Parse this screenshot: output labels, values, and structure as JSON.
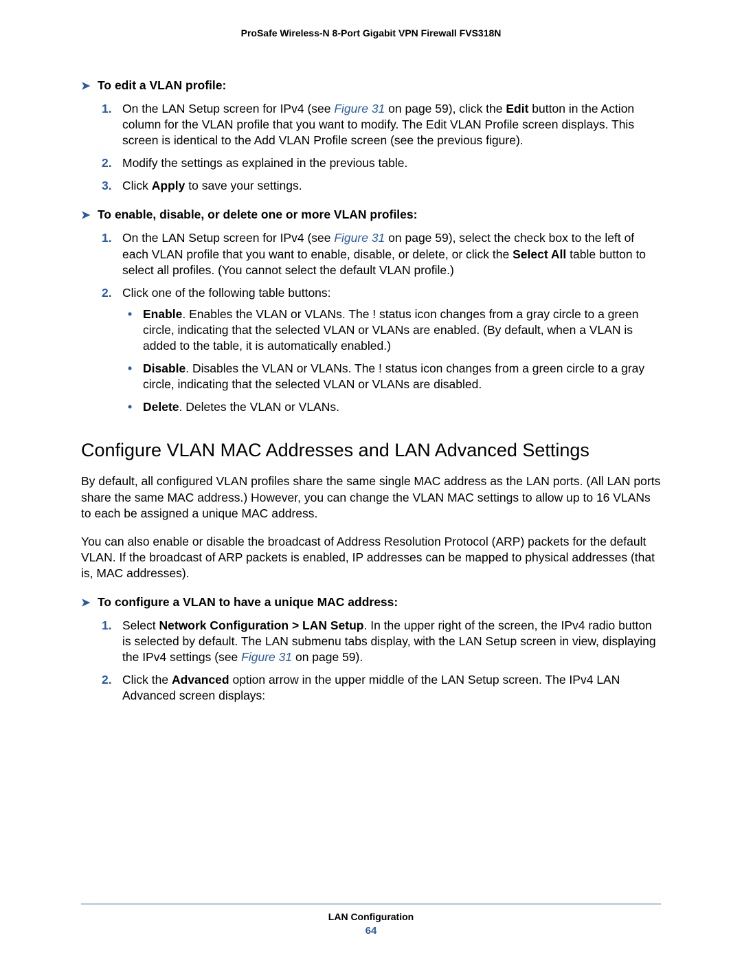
{
  "header": {
    "title": "ProSafe Wireless-N 8-Port Gigabit VPN Firewall FVS318N"
  },
  "proc1": {
    "heading": "To edit a VLAN profile:",
    "steps": [
      {
        "num": "1.",
        "segs": [
          {
            "t": "On the LAN Setup screen for IPv4 (see "
          },
          {
            "t": "Figure 31",
            "cls": "link"
          },
          {
            "t": " on page 59), click the "
          },
          {
            "t": "Edit",
            "cls": "bold"
          },
          {
            "t": " button in the Action column for the VLAN profile that you want to modify. The Edit VLAN Profile screen displays. This screen is identical to the Add VLAN Profile screen (see the previous figure)."
          }
        ]
      },
      {
        "num": "2.",
        "segs": [
          {
            "t": "Modify the settings as explained in the previous table."
          }
        ]
      },
      {
        "num": "3.",
        "segs": [
          {
            "t": "Click "
          },
          {
            "t": "Apply",
            "cls": "bold"
          },
          {
            "t": " to save your settings."
          }
        ]
      }
    ]
  },
  "proc2": {
    "heading": "To enable, disable, or delete one or more VLAN profiles:",
    "steps": [
      {
        "num": "1.",
        "segs": [
          {
            "t": "On the LAN Setup screen for IPv4 (see "
          },
          {
            "t": "Figure 31",
            "cls": "link"
          },
          {
            "t": " on page 59), select the check box to the left of each VLAN profile that you want to enable, disable, or delete, or click the "
          },
          {
            "t": "Select All",
            "cls": "bold"
          },
          {
            "t": " table button to select all profiles. (You cannot select the default VLAN profile.)"
          }
        ]
      },
      {
        "num": "2.",
        "segs": [
          {
            "t": "Click one of the following table buttons:"
          }
        ],
        "bullets": [
          {
            "segs": [
              {
                "t": "Enable",
                "cls": "bold"
              },
              {
                "t": ". Enables the VLAN or VLANs. The ! status icon changes from a gray circle to a green circle, indicating that the selected VLAN or VLANs are enabled. (By default, when a VLAN is added to the table, it is automatically enabled.)"
              }
            ]
          },
          {
            "segs": [
              {
                "t": "Disable",
                "cls": "bold"
              },
              {
                "t": ". Disables the VLAN or VLANs. The ! status icon changes from a green circle to a gray circle, indicating that the selected VLAN or VLANs are disabled."
              }
            ]
          },
          {
            "segs": [
              {
                "t": "Delete",
                "cls": "bold"
              },
              {
                "t": ". Deletes the VLAN or VLANs."
              }
            ]
          }
        ]
      }
    ]
  },
  "section": {
    "heading": "Configure VLAN MAC Addresses and LAN Advanced Settings",
    "para1": "By default, all configured VLAN profiles share the same single MAC address as the LAN ports. (All LAN ports share the same MAC address.) However, you can change the VLAN MAC settings to allow up to 16 VLANs to each be assigned a unique MAC address.",
    "para2": "You can also enable or disable the broadcast of Address Resolution Protocol (ARP) packets for the default VLAN. If the broadcast of ARP packets is enabled, IP addresses can be mapped to physical addresses (that is, MAC addresses)."
  },
  "proc3": {
    "heading": "To configure a VLAN to have a unique MAC address:",
    "steps": [
      {
        "num": "1.",
        "segs": [
          {
            "t": "Select "
          },
          {
            "t": "Network Configuration > LAN Setup",
            "cls": "bold"
          },
          {
            "t": ". In the upper right of the screen, the IPv4 radio button is selected by default. The LAN submenu tabs display, with the LAN Setup screen in view, displaying the IPv4 settings (see "
          },
          {
            "t": "Figure 31",
            "cls": "link"
          },
          {
            "t": " on page 59)."
          }
        ]
      },
      {
        "num": "2.",
        "segs": [
          {
            "t": "Click the "
          },
          {
            "t": "Advanced",
            "cls": "bold"
          },
          {
            "t": " option arrow in the upper middle of the LAN Setup screen. The IPv4 LAN Advanced screen displays:"
          }
        ]
      }
    ]
  },
  "footer": {
    "label": "LAN Configuration",
    "pagenum": "64"
  }
}
